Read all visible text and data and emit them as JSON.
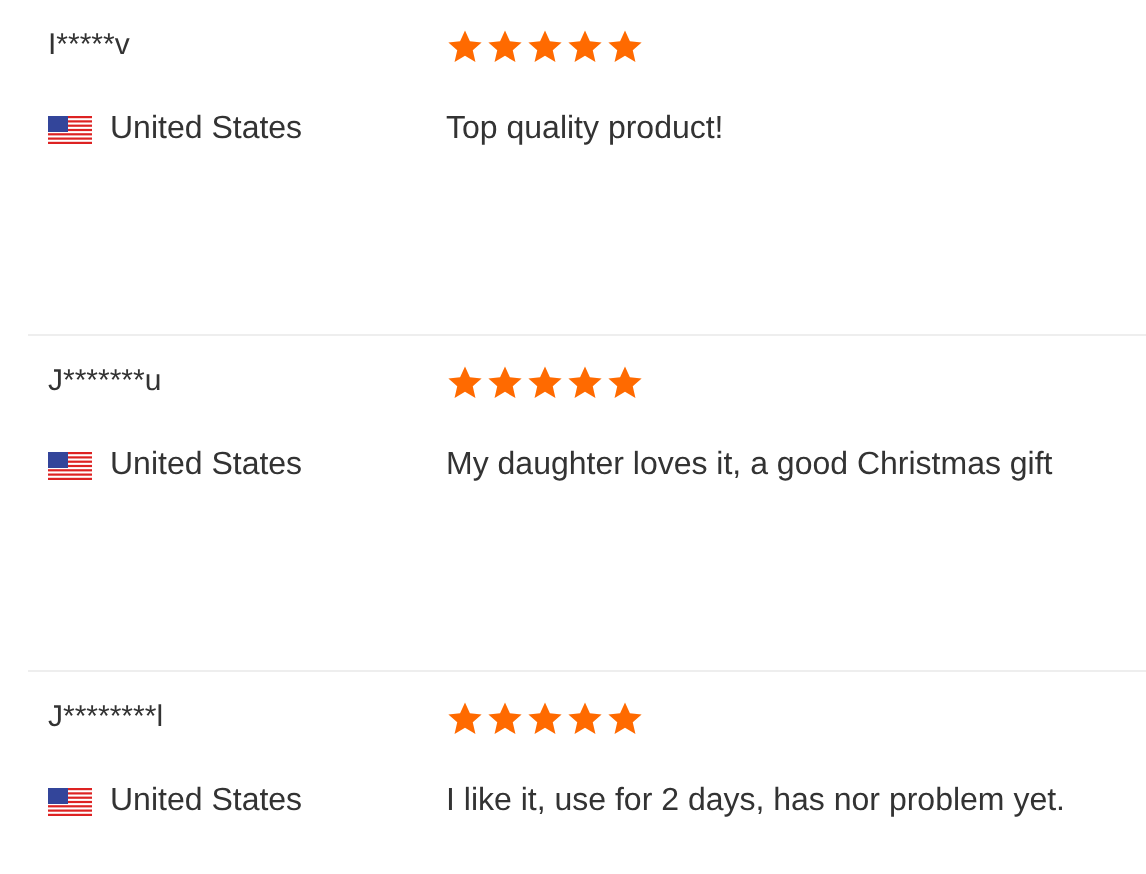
{
  "reviews": [
    {
      "name": "I*****v",
      "country": "United States",
      "stars": 5,
      "text": "Top quality product!"
    },
    {
      "name": "J*******u",
      "country": "United States",
      "stars": 5,
      "text": "My daughter loves it, a good Christmas gift"
    },
    {
      "name": "J********l",
      "country": "United States",
      "stars": 5,
      "text": "I like it, use for 2 days, has nor problem yet."
    }
  ]
}
